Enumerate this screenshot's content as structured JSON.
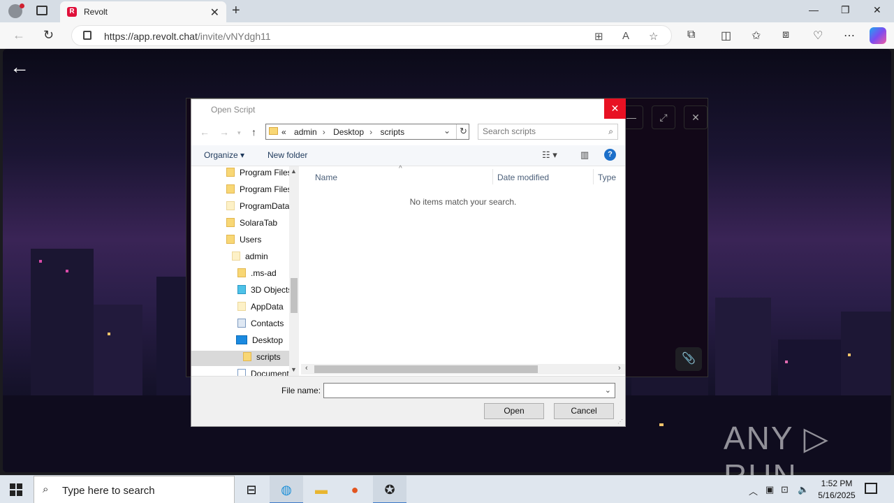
{
  "browser": {
    "tab_title": "Revolt",
    "tab_favicon": "R",
    "url_host": "https://app.revolt.chat",
    "url_path": "/invite/vNYdgh11"
  },
  "page": {
    "watermark": "ANY ▷ RUN"
  },
  "dialog": {
    "title": "Open Script",
    "path": [
      "admin",
      "Desktop",
      "scripts"
    ],
    "path_prefix": "«",
    "search_placeholder": "Search scripts",
    "organize_label": "Organize ▾",
    "new_folder_label": "New folder",
    "help_label": "?",
    "tree": [
      {
        "label": "Program Files",
        "icon": "folder"
      },
      {
        "label": "Program Files",
        "icon": "folder"
      },
      {
        "label": "ProgramData",
        "icon": "folder-pale"
      },
      {
        "label": "SolaraTab",
        "icon": "folder"
      },
      {
        "label": "Users",
        "icon": "folder"
      },
      {
        "label": "admin",
        "icon": "folder-pale"
      },
      {
        "label": ".ms-ad",
        "icon": "folder"
      },
      {
        "label": "3D Objects",
        "icon": "3d-objects"
      },
      {
        "label": "AppData",
        "icon": "folder-pale"
      },
      {
        "label": "Contacts",
        "icon": "contacts"
      },
      {
        "label": "Desktop",
        "icon": "desktop"
      },
      {
        "label": "scripts",
        "icon": "folder"
      },
      {
        "label": "Documents",
        "icon": "documents"
      }
    ],
    "columns": {
      "name": "Name",
      "date": "Date modified",
      "type": "Type"
    },
    "empty_message": "No items match your search.",
    "file_name_label": "File name:",
    "file_name_value": "",
    "open_label": "Open",
    "cancel_label": "Cancel"
  },
  "taskbar": {
    "search_placeholder": "Type here to search",
    "time": "1:52 PM",
    "date": "5/16/2025"
  },
  "colors": {
    "close_red": "#e81123",
    "help_blue": "#1c6fc9",
    "brand_red": "#e0103a"
  }
}
